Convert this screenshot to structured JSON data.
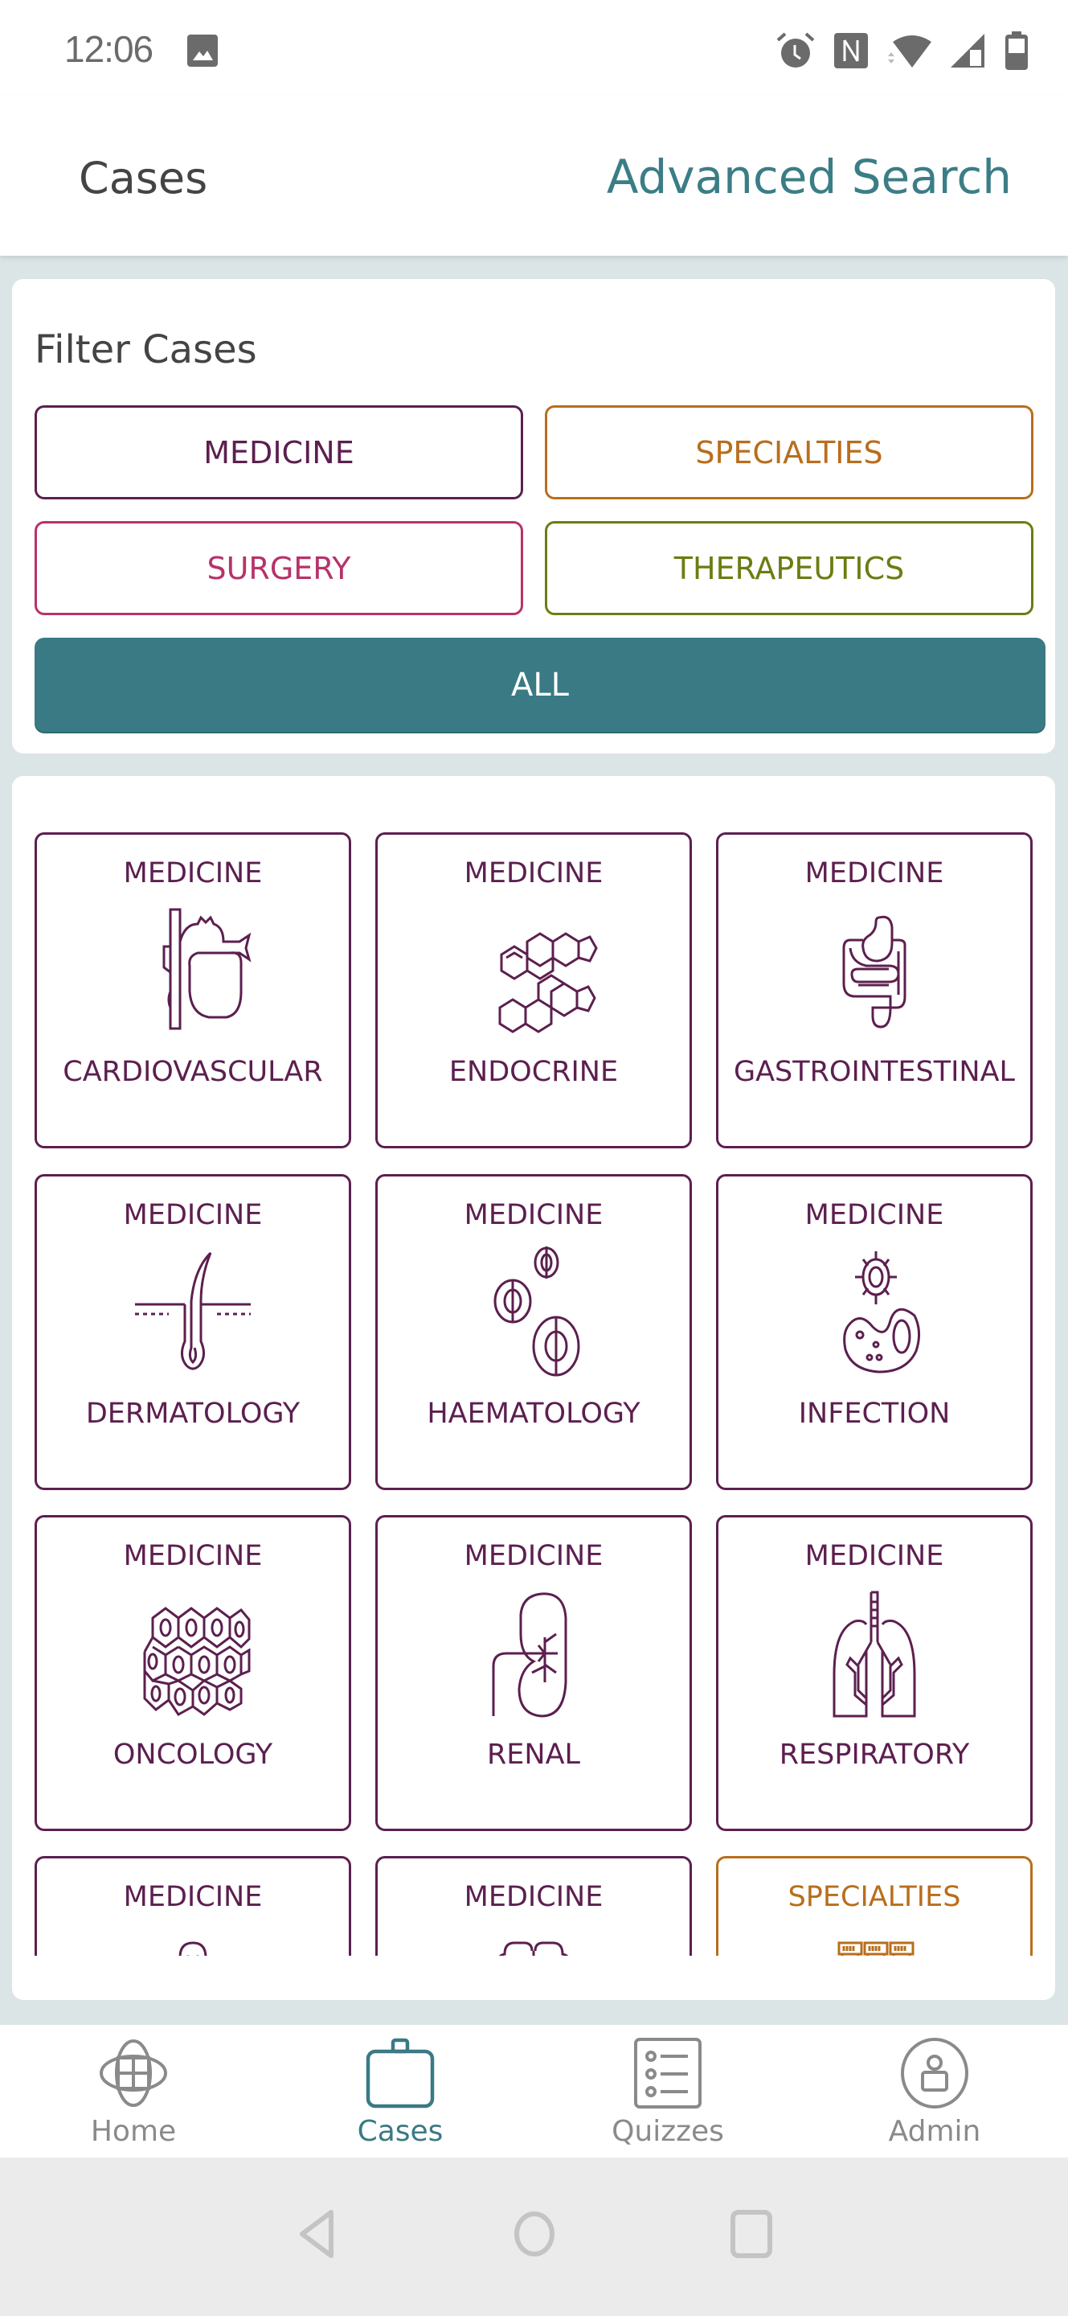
{
  "status_bar": {
    "time": "12:06",
    "icons": [
      "image-notification-icon",
      "alarm-icon",
      "nfc-icon",
      "wifi-icon",
      "signal-icon",
      "battery-icon"
    ]
  },
  "header": {
    "title": "Cases",
    "advanced_search": "Advanced Search"
  },
  "filter": {
    "title": "Filter Cases",
    "buttons": [
      {
        "label": "MEDICINE",
        "color": "#5c1f4f"
      },
      {
        "label": "SPECIALTIES",
        "color": "#b86e1c"
      },
      {
        "label": "SURGERY",
        "color": "#b8326a"
      },
      {
        "label": "THERAPEUTICS",
        "color": "#6b7d12"
      }
    ],
    "all_label": "ALL",
    "all_color": "#3a7a84"
  },
  "cases": [
    {
      "category": "MEDICINE",
      "name": "CARDIOVASCULAR",
      "icon": "heart-icon"
    },
    {
      "category": "MEDICINE",
      "name": "ENDOCRINE",
      "icon": "molecule-icon"
    },
    {
      "category": "MEDICINE",
      "name": "GASTROINTESTINAL",
      "icon": "intestine-icon"
    },
    {
      "category": "MEDICINE",
      "name": "DERMATOLOGY",
      "icon": "hair-follicle-icon"
    },
    {
      "category": "MEDICINE",
      "name": "HAEMATOLOGY",
      "icon": "blood-cells-icon"
    },
    {
      "category": "MEDICINE",
      "name": "INFECTION",
      "icon": "microbe-icon"
    },
    {
      "category": "MEDICINE",
      "name": "ONCOLOGY",
      "icon": "cells-icon"
    },
    {
      "category": "MEDICINE",
      "name": "RENAL",
      "icon": "kidney-icon"
    },
    {
      "category": "MEDICINE",
      "name": "RESPIRATORY",
      "icon": "lungs-icon"
    },
    {
      "category": "MEDICINE",
      "name": "",
      "icon": "skeleton-icon"
    },
    {
      "category": "MEDICINE",
      "name": "",
      "icon": "brain-icon"
    },
    {
      "category": "SPECIALTIES",
      "name": "",
      "icon": "test-tubes-icon"
    }
  ],
  "bottom_nav": {
    "items": [
      {
        "label": "Home",
        "icon": "home-icon",
        "active": false
      },
      {
        "label": "Cases",
        "icon": "briefcase-icon",
        "active": true
      },
      {
        "label": "Quizzes",
        "icon": "list-icon",
        "active": false
      },
      {
        "label": "Admin",
        "icon": "user-icon",
        "active": false
      }
    ],
    "active_color": "#3a7a84",
    "inactive_color": "#8a8a8a"
  },
  "system_nav": {
    "buttons": [
      "back",
      "home",
      "recents"
    ]
  }
}
